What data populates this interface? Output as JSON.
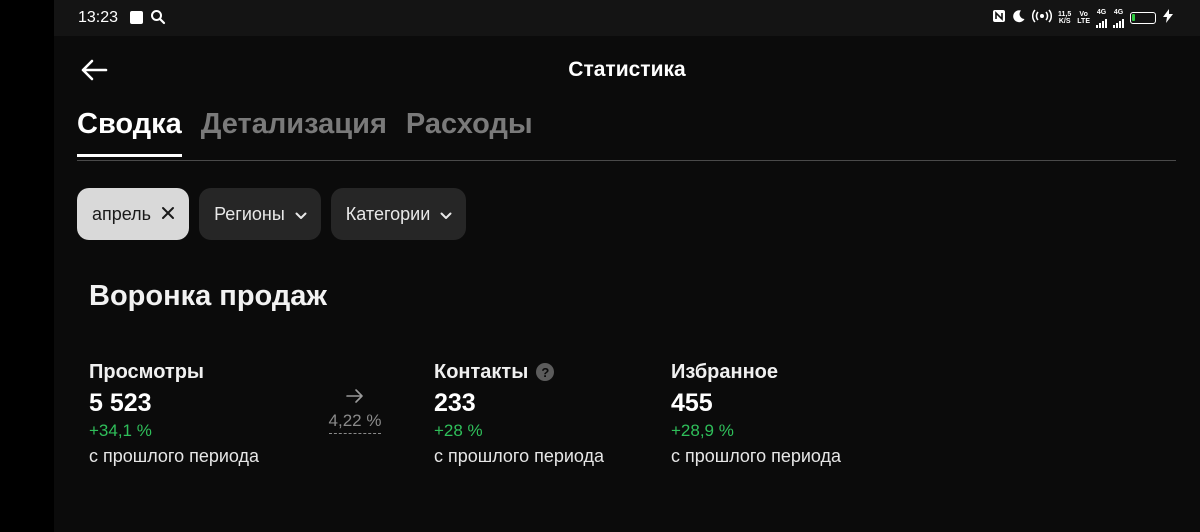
{
  "status_bar": {
    "time": "13:23",
    "net_speed_value": "11,5",
    "net_speed_unit": "K/S",
    "volte_top": "Vo",
    "volte_bottom": "LTE",
    "sim1_label": "4G",
    "sim2_label": "4G",
    "icons": [
      "notification-square-icon",
      "search-icon",
      "nfc-icon",
      "moon-icon",
      "hotspot-icon",
      "signal-icon",
      "battery-icon",
      "charging-icon"
    ]
  },
  "header": {
    "title": "Статистика"
  },
  "tabs": [
    {
      "label": "Сводка",
      "active": true
    },
    {
      "label": "Детализация",
      "active": false
    },
    {
      "label": "Расходы",
      "active": false
    }
  ],
  "filters": [
    {
      "label": "апрель",
      "icon": "close-icon",
      "active": true
    },
    {
      "label": "Регионы",
      "icon": "chevron-down-icon",
      "active": false
    },
    {
      "label": "Категории",
      "icon": "chevron-down-icon",
      "active": false
    }
  ],
  "funnel": {
    "title": "Воронка продаж",
    "metrics": [
      {
        "label": "Просмотры",
        "value": "5 523",
        "delta": "+34,1 %",
        "sub": "с прошлого периода"
      },
      {
        "label": "Контакты",
        "value": "233",
        "delta": "+28 %",
        "sub": "с прошлого периода",
        "help": "?"
      },
      {
        "label": "Избранное",
        "value": "455",
        "delta": "+28,9 %",
        "sub": "с прошлого периода"
      }
    ],
    "conversion": "4,22 %"
  },
  "colors": {
    "background": "#0b0b0b",
    "positive": "#2fbf5a",
    "chip_bg": "#262626",
    "chip_active_bg": "#d9d9d9",
    "muted": "#7a7a7a"
  }
}
